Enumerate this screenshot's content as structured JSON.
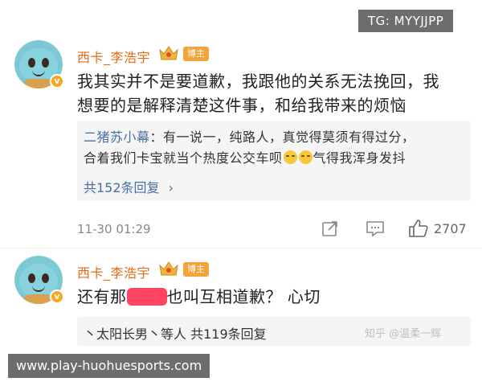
{
  "watermark_top": "TG: MYYJJPP",
  "watermark_bottom": "www.play-huohuesports.com",
  "zhihu_watermark": "知乎 @温柔一辉",
  "comment1": {
    "username": "西卡_李浩宇",
    "host_badge": "博主",
    "content_line1": "我其实并不是要道歉，我跟他的关系无法挽回，我",
    "content_line2": "想要的是解释清楚这件事，和给我带来的烦恼",
    "reply": {
      "author": "二猪苏小幕",
      "line1": "：有一说一，纯路人，真觉得莫须有得过分，",
      "line2_a": "合着我们卡宝就当个热度公交车呗",
      "line2_b": "气得我浑身发抖",
      "count": "共152条回复",
      "chevron": "›"
    },
    "timestamp": "11-30 01:29",
    "likes": "2707"
  },
  "comment2": {
    "username": "西卡_李浩宇",
    "host_badge": "博主",
    "content_a": "还有那",
    "content_b": "也叫互相道歉？ 心切",
    "reply_row": "丶太阳长男丶等人  共119条回复"
  },
  "colors": {
    "username": "#e26b16",
    "link": "#4a6fa5",
    "badge": "#f2a33a"
  }
}
